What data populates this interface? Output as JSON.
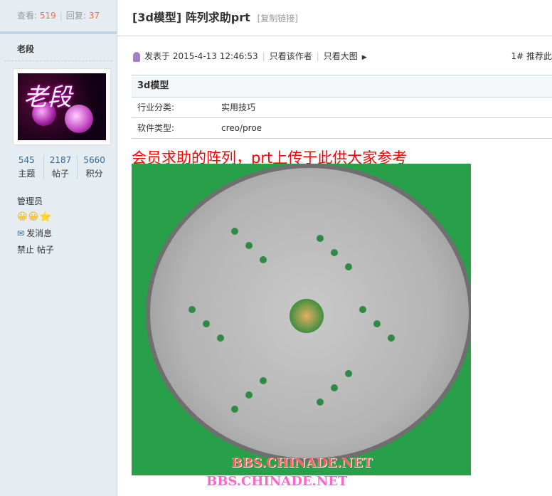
{
  "sidebar": {
    "stats": {
      "views_label": "查看:",
      "views": "519",
      "replies_label": "回复:",
      "replies": "37"
    },
    "author": "老段",
    "avatar_text": "老段",
    "counts": [
      {
        "value": "545",
        "label": "主题"
      },
      {
        "value": "2187",
        "label": "帖子"
      },
      {
        "value": "5660",
        "label": "积分"
      }
    ],
    "group": "管理员",
    "rank_icons": "😀😀⭐",
    "send_message": "发消息",
    "ban_label": "禁止 帖子"
  },
  "post": {
    "title": "[3d模型] 阵列求助prt",
    "copy_link": "[复制链接]",
    "posted_on": "发表于 2015-4-13 12:46:53",
    "only_author": "只看该作者",
    "only_images": "只看大图",
    "floor": "1# 推荐此",
    "info": {
      "header": "3d模型",
      "rows": [
        {
          "key": "行业分类:",
          "value": "实用技巧"
        },
        {
          "key": "软件类型:",
          "value": "creo/proe"
        }
      ]
    },
    "headline": "会员求助的阵列，prt上传于此供大家参考",
    "watermark": "BBS.CHINADE.NET"
  }
}
